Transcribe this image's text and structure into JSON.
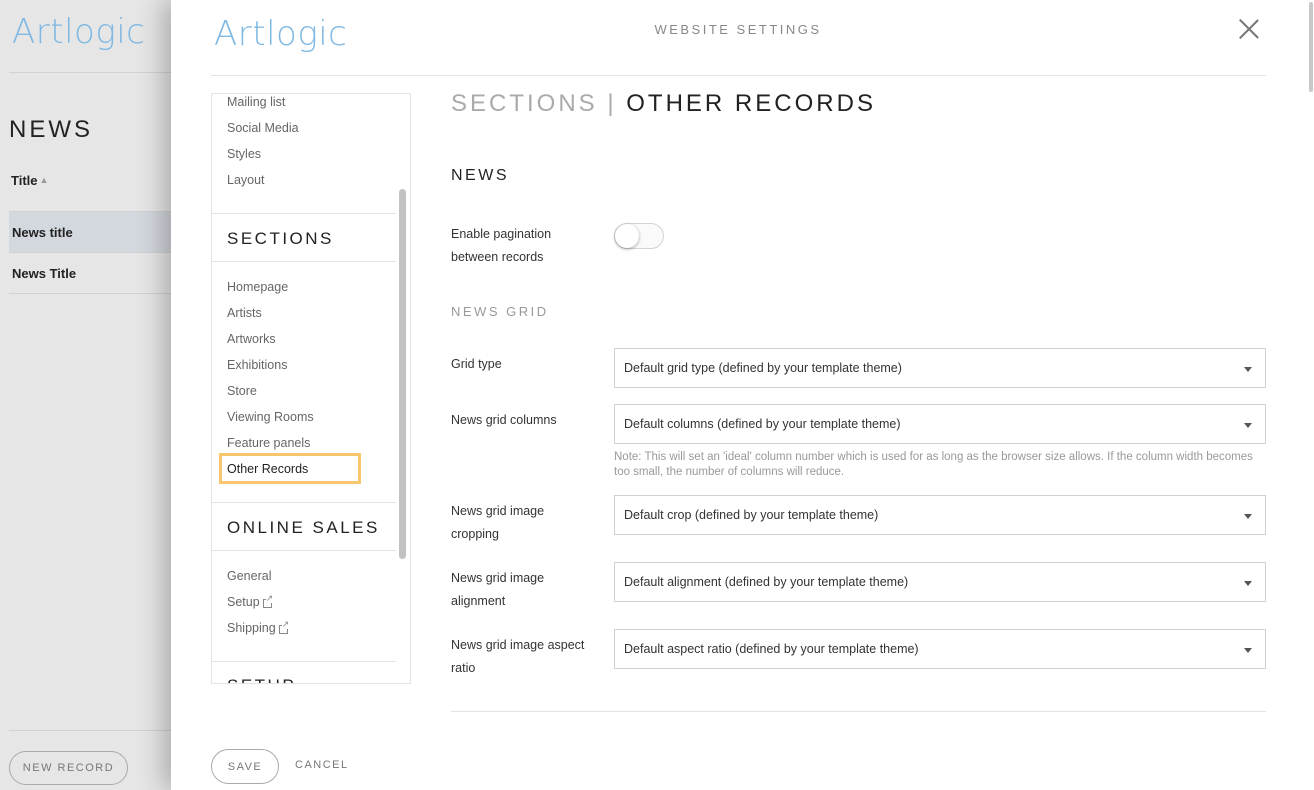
{
  "background": {
    "logo": "Artlogic",
    "page_title": "NEWS",
    "column_title": "Title",
    "rows": [
      "News title",
      "News Title"
    ],
    "new_record_label": "NEW RECORD"
  },
  "modal": {
    "logo": "Artlogic",
    "title": "WEBSITE SETTINGS",
    "nav": {
      "items_top": [
        "Mailing list",
        "Social Media",
        "Styles",
        "Layout"
      ],
      "sections_heading": "SECTIONS",
      "sections_items": [
        "Homepage",
        "Artists",
        "Artworks",
        "Exhibitions",
        "Store",
        "Viewing Rooms",
        "Feature panels",
        "Other Records"
      ],
      "online_sales_heading": "ONLINE SALES",
      "online_sales_items": [
        "General",
        "Setup",
        "Shipping"
      ],
      "setup_heading": "SETUP"
    },
    "section_title_prefix": "SECTIONS",
    "section_title_sep": "|",
    "section_title_name": "OTHER RECORDS",
    "group_heading": "NEWS",
    "pagination_label": "Enable pagination between records",
    "pagination_enabled": false,
    "grid_heading": "NEWS GRID",
    "fields": [
      {
        "label": "Grid type",
        "value": "Default grid type (defined by your template theme)"
      },
      {
        "label": "News grid columns",
        "value": "Default columns (defined by your template theme)"
      },
      {
        "label": "News grid image cropping",
        "value": "Default crop (defined by your template theme)"
      },
      {
        "label": "News grid image alignment",
        "value": "Default alignment (defined by your template theme)"
      },
      {
        "label": "News grid image aspect ratio",
        "value": "Default aspect ratio (defined by your template theme)"
      }
    ],
    "columns_note": "Note: This will set an 'ideal' column number which is used for as long as the browser size allows. If the column width becomes too small, the number of columns will reduce.",
    "save_label": "SAVE",
    "cancel_label": "CANCEL"
  },
  "colors": {
    "logo": "#7fb8e2",
    "selected_highlight": "#f7c66d",
    "selected_row": "#d3d7de"
  }
}
